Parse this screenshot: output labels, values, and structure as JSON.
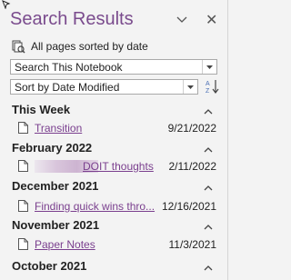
{
  "header": {
    "title": "Search Results"
  },
  "scope": {
    "label": "All pages sorted by date"
  },
  "search_scope_select": {
    "value": "Search This Notebook"
  },
  "sort_select": {
    "value": "Sort by Date Modified"
  },
  "groups": [
    {
      "label": "This Week",
      "items": [
        {
          "title": "Transition",
          "date": "9/21/2022"
        }
      ]
    },
    {
      "label": "February 2022",
      "items": [
        {
          "title": "DOIT thoughts",
          "date": "2/11/2022"
        }
      ]
    },
    {
      "label": "December 2021",
      "items": [
        {
          "title": "Finding quick wins thro...",
          "date": "12/16/2021"
        }
      ]
    },
    {
      "label": "November 2021",
      "items": [
        {
          "title": "Paper Notes",
          "date": "11/3/2021"
        }
      ]
    },
    {
      "label": "October 2021",
      "items": []
    }
  ],
  "colors": {
    "accent": "#7a4b8d",
    "link": "#7a3f8e"
  }
}
